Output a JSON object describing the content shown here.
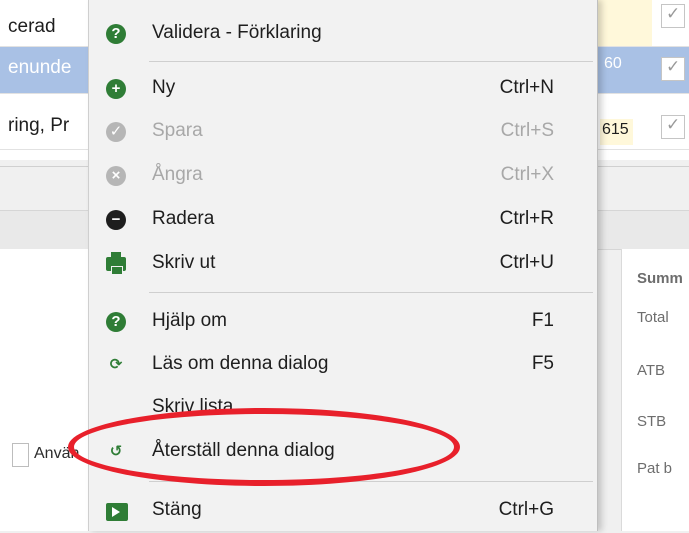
{
  "background": {
    "rows": [
      {
        "text": "cerad",
        "number": "",
        "checked": true
      },
      {
        "text": "enunde",
        "number": "60",
        "checked": true
      },
      {
        "text": "ring, Pr",
        "number": "615",
        "checked": true
      }
    ],
    "checkmark": "✓",
    "lower_left_label": "Använ",
    "summary": {
      "heading": "Summ",
      "items": [
        "Total",
        "ATB",
        "STB",
        "Pat b"
      ]
    }
  },
  "menu": {
    "items": [
      {
        "label": "Validera - Förklaring",
        "shortcut": "",
        "icon": "help-icon",
        "enabled": true
      },
      {
        "label": "Ny",
        "shortcut": "Ctrl+N",
        "icon": "add-icon",
        "enabled": true
      },
      {
        "label": "Spara",
        "shortcut": "Ctrl+S",
        "icon": "check-icon",
        "enabled": false
      },
      {
        "label": "Ångra",
        "shortcut": "Ctrl+X",
        "icon": "cancel-icon",
        "enabled": false
      },
      {
        "label": "Radera",
        "shortcut": "Ctrl+R",
        "icon": "remove-icon",
        "enabled": true
      },
      {
        "label": "Skriv ut",
        "shortcut": "Ctrl+U",
        "icon": "printer-icon",
        "enabled": true
      },
      {
        "label": "Hjälp om",
        "shortcut": "F1",
        "icon": "help-icon",
        "enabled": true
      },
      {
        "label": "Läs om denna dialog",
        "shortcut": "F5",
        "icon": "reload-icon",
        "enabled": true
      },
      {
        "label": "Skriv lista",
        "shortcut": "",
        "icon": "",
        "enabled": true
      },
      {
        "label": "Återställ denna dialog",
        "shortcut": "",
        "icon": "reset-icon",
        "enabled": true
      },
      {
        "label": "Stäng",
        "shortcut": "Ctrl+G",
        "icon": "exit-icon",
        "enabled": true
      }
    ]
  },
  "colors": {
    "accent_green": "#2f7d36",
    "selection_blue": "#a9c1e5",
    "highlight_red": "#e8202b",
    "disabled_grey": "#a8a8a8"
  }
}
